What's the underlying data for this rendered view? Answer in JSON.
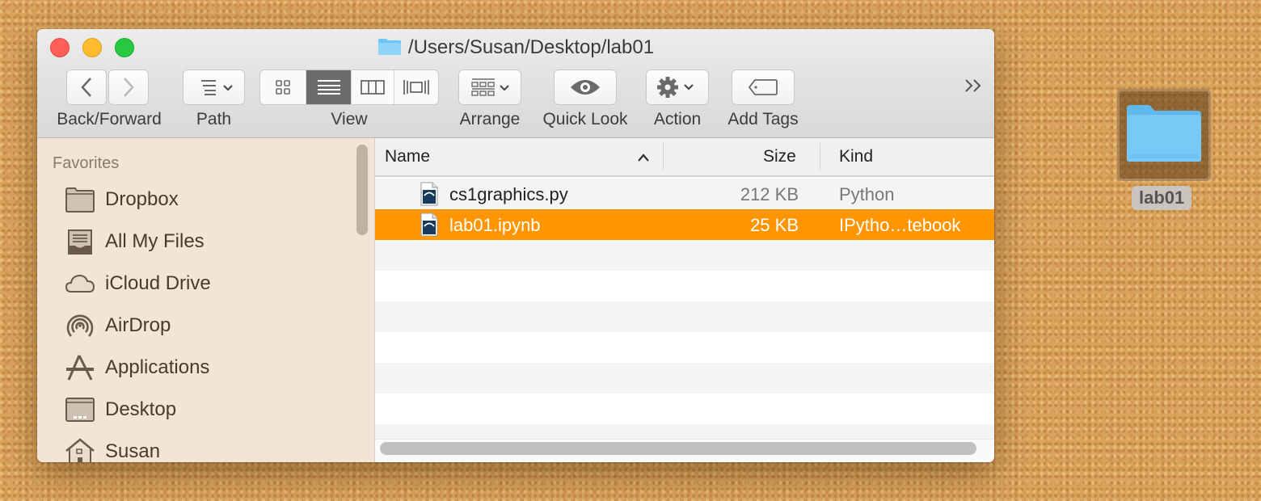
{
  "window": {
    "title": "/Users/Susan/Desktop/lab01"
  },
  "toolbar": {
    "back_forward_label": "Back/Forward",
    "path_label": "Path",
    "view_label": "View",
    "arrange_label": "Arrange",
    "quick_look_label": "Quick Look",
    "action_label": "Action",
    "add_tags_label": "Add Tags",
    "overflow_label": "»",
    "active_view": "list"
  },
  "sidebar": {
    "section": "Favorites",
    "items": [
      {
        "label": "Dropbox",
        "icon": "folder-icon"
      },
      {
        "label": "All My Files",
        "icon": "all-files-icon"
      },
      {
        "label": "iCloud Drive",
        "icon": "cloud-icon"
      },
      {
        "label": "AirDrop",
        "icon": "airdrop-icon"
      },
      {
        "label": "Applications",
        "icon": "applications-icon"
      },
      {
        "label": "Desktop",
        "icon": "desktop-icon"
      },
      {
        "label": "Susan",
        "icon": "home-icon"
      }
    ]
  },
  "list": {
    "columns": {
      "name": "Name",
      "size": "Size",
      "kind": "Kind"
    },
    "sort_indicator": "^",
    "rows": [
      {
        "name": "cs1graphics.py",
        "size": "212 KB",
        "kind": "Python",
        "selected": false
      },
      {
        "name": "lab01.ipynb",
        "size": "25 KB",
        "kind": "IPytho…tebook",
        "selected": true
      }
    ]
  },
  "desktop": {
    "item_label": "lab01"
  },
  "colors": {
    "selection": "#ff9500",
    "folder_blue": "#6cc4f5",
    "sidebar_bg": "#f2e4d6"
  }
}
